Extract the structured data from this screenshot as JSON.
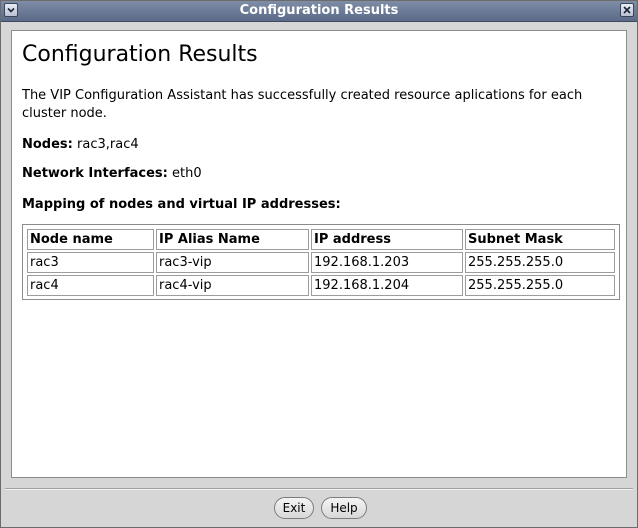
{
  "window": {
    "title": "Configuration Results"
  },
  "content": {
    "heading": "Configuration Results",
    "description": "The VIP Configuration Assistant has successfully created resource aplications for each cluster node.",
    "nodes_label": "Nodes:",
    "nodes_value": "rac3,rac4",
    "network_label": "Network Interfaces:",
    "network_value": "eth0",
    "mapping_title": "Mapping of nodes and virtual IP addresses:"
  },
  "table": {
    "headers": [
      "Node name",
      "IP Alias Name",
      "IP address",
      "Subnet Mask"
    ],
    "rows": [
      [
        "rac3",
        "rac3-vip",
        "192.168.1.203",
        "255.255.255.0"
      ],
      [
        "rac4",
        "rac4-vip",
        "192.168.1.204",
        "255.255.255.0"
      ]
    ]
  },
  "buttons": {
    "exit": "Exit",
    "help": "Help"
  },
  "icons": {
    "window_menu": "chevron-down-icon",
    "window_close": "close-icon"
  },
  "colors": {
    "titlebar": "#5a6a88",
    "window_bg": "#d6d6d6",
    "content_bg": "#ffffff"
  }
}
